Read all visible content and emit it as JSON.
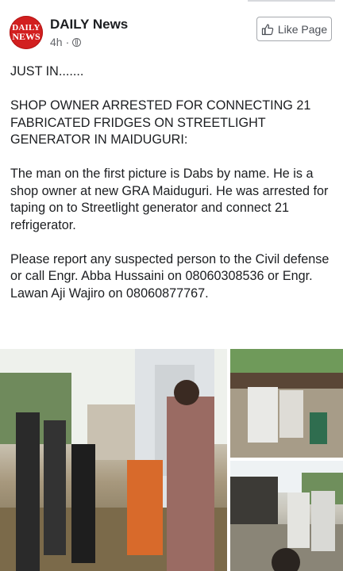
{
  "post": {
    "page_name": "DAILY News",
    "time": "4h",
    "meta_separator": "·",
    "like_button_label": "Like Page",
    "avatar_logo_line1": "DAILY",
    "avatar_logo_line2": "NEWS",
    "paragraphs": [
      "JUST IN.......",
      "SHOP OWNER ARRESTED FOR CONNECTING 21 FABRICATED FRIDGES ON STREETLIGHT GENERATOR IN MAIDUGURI:",
      "The man on the first picture is Dabs by name. He is a shop owner at new GRA Maiduguri. He was arrested for taping on to Streetlight generator and connect 21 refrigerator.",
      "Please report any suspected person to the Civil defense or call Engr. Abba Hussaini on 08060308536 or Engr. Lawan Aji Wajiro on 08060877767."
    ]
  },
  "icons": {
    "globe": "globe-icon",
    "like": "thumbs-up-icon"
  },
  "colors": {
    "brand_red": "#d21f1f",
    "meta_gray": "#65676b",
    "text": "#1c1e21"
  }
}
